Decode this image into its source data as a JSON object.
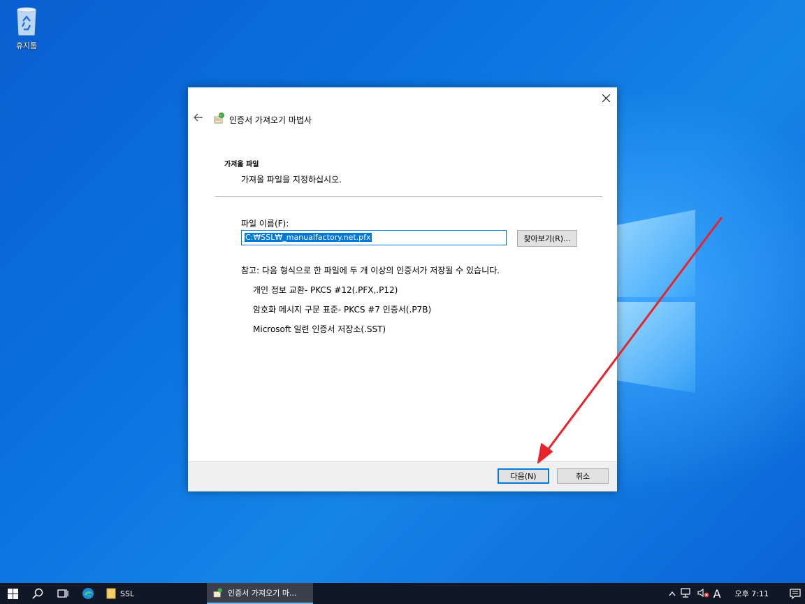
{
  "desktop": {
    "recycle_bin_label": "휴지통"
  },
  "dialog": {
    "wizard_title": "인증서 가져오기 마법사",
    "section_title": "가져올 파일",
    "section_subtitle": "가져올 파일을 지정하십시오.",
    "file_label": "파일 이름(F):",
    "file_value": "C:₩SSL₩_manualfactory.net.pfx",
    "browse_label": "찾아보기(R)...",
    "note": "참고: 다음 형식으로 한 파일에 두 개 이상의 인증서가 저장될 수 있습니다.",
    "formats": [
      "개인 정보 교환- PKCS #12(.PFX,.P12)",
      "암호화 메시지 구문 표준- PKCS #7 인증서(.P7B)",
      "Microsoft 일련 인증서 저장소(.SST)"
    ],
    "next_label": "다음(N)",
    "cancel_label": "취소"
  },
  "taskbar": {
    "tasks": [
      {
        "label": "SSL"
      },
      {
        "label": "인증서 가져오기 마..."
      }
    ],
    "ime_indicator": "A",
    "clock": "오후 7:11"
  },
  "colors": {
    "accent": "#0078d7",
    "annotation_arrow": "#e8232b",
    "taskbar": "#101828"
  }
}
